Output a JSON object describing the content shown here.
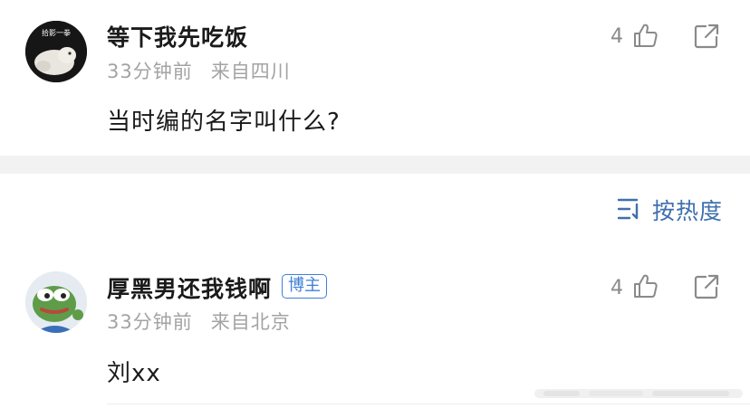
{
  "comments": [
    {
      "username": "等下我先吃饭",
      "avatar_text": "拾影一拳",
      "time": "33分钟前",
      "location": "来自四川",
      "content": "当时编的名字叫什么?",
      "likes": "4",
      "badge": ""
    },
    {
      "username": "厚黑男还我钱啊",
      "badge": "博主",
      "time": "33分钟前",
      "location": "来自北京",
      "content": "刘xx",
      "likes": "4"
    }
  ],
  "sort": {
    "label": "按热度"
  },
  "icons": {
    "like": "thumbs-up-icon",
    "share": "share-icon",
    "sort": "sort-icon"
  },
  "colors": {
    "accent": "#3f6fae",
    "badge": "#3f7fd8",
    "meta": "#a3a3a3",
    "band": "#f2f2f2"
  }
}
